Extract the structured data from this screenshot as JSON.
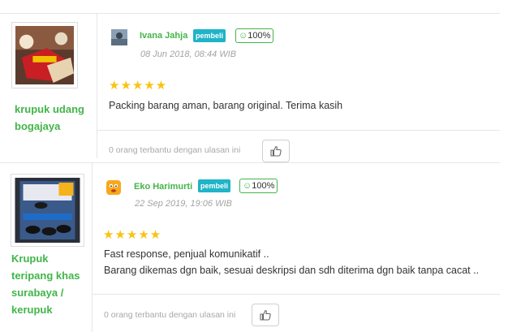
{
  "reviews": [
    {
      "product_name": "krupuk udang bogajaya",
      "reviewer": "Ivana Jahja",
      "badge": "pembeli",
      "rating_label": "100%",
      "date": "08 Jun 2018, 08:44 WIB",
      "stars": "★★★★★",
      "lines": [
        "Packing barang aman, barang original. Terima kasih"
      ],
      "helpful_text": "0 orang terbantu dengan ulasan ini"
    },
    {
      "product_name": "Krupuk teripang khas surabaya / kerupuk",
      "reviewer": "Eko Harimurti",
      "badge": "pembeli",
      "rating_label": "100%",
      "date": "22 Sep 2019, 19:06 WIB",
      "stars": "★★★★★",
      "lines": [
        "Fast response, penjual komunikatif ..",
        "Barang dikemas dgn baik, sesuai deskripsi dan sdh diterima dgn baik tanpa cacat .."
      ],
      "helpful_text": "0 orang terbantu dengan ulasan ini"
    }
  ],
  "colors": {
    "accent": "#42b549",
    "badge": "#1fb4c7",
    "star": "#f9c311"
  }
}
